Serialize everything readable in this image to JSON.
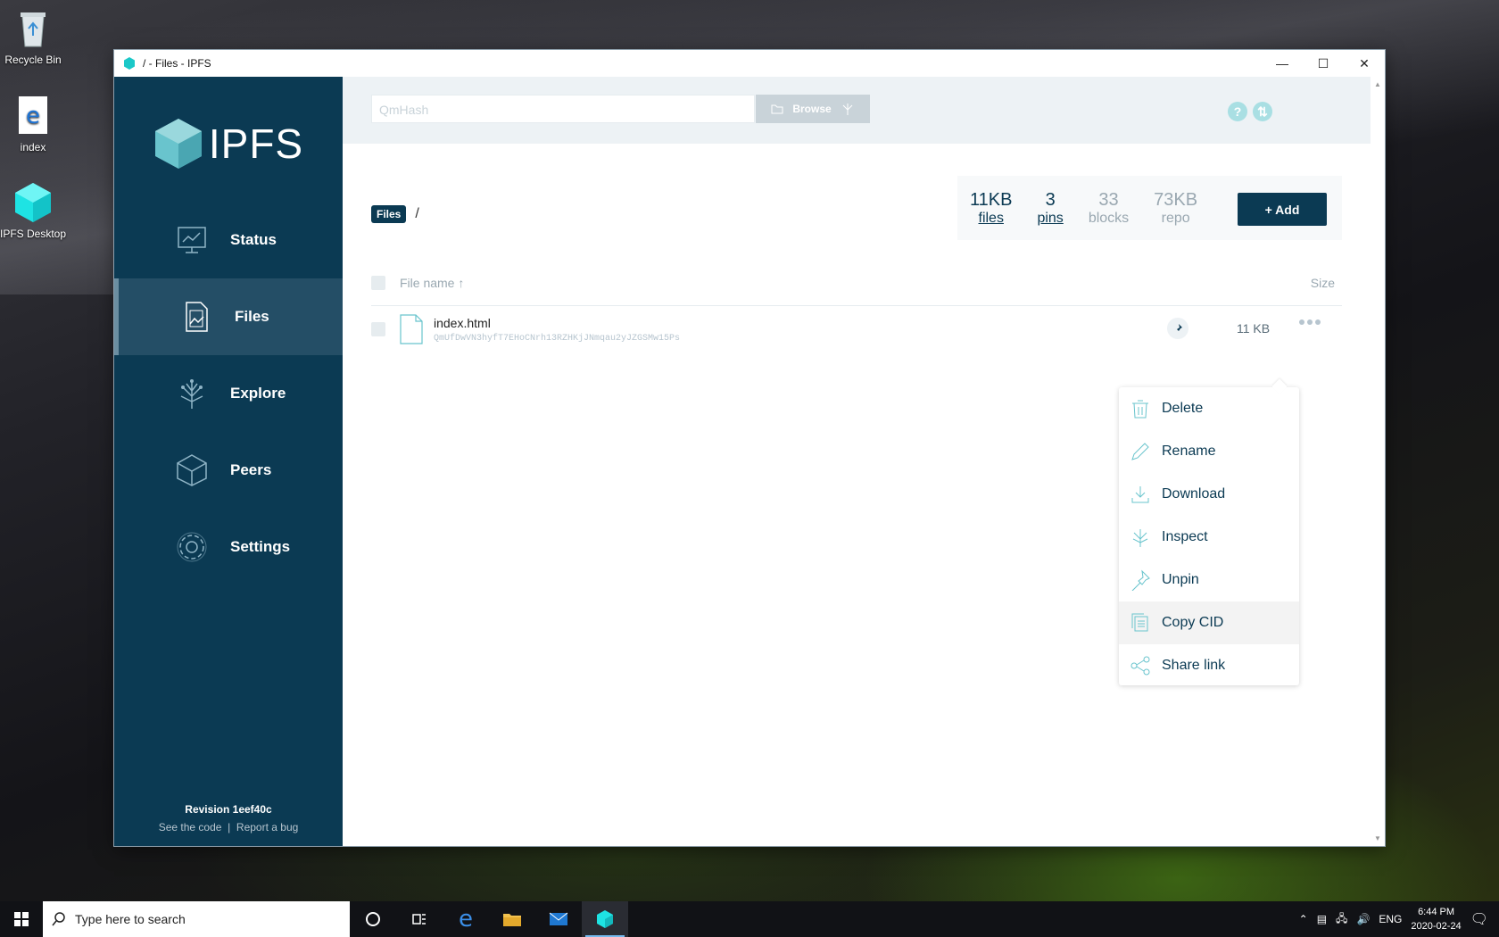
{
  "desktop": {
    "icons": [
      {
        "label": "Recycle Bin",
        "icon": "recycle-bin-icon"
      },
      {
        "label": "index",
        "icon": "edge-file-icon"
      },
      {
        "label": "IPFS Desktop",
        "icon": "ipfs-cube-icon"
      }
    ]
  },
  "window": {
    "title": "/ - Files - IPFS",
    "controls": [
      "minimize",
      "maximize",
      "close"
    ]
  },
  "sidebar": {
    "logo_text": "IPFS",
    "items": [
      {
        "label": "Status",
        "icon": "status-monitor-icon"
      },
      {
        "label": "Files",
        "icon": "files-icon",
        "active": true
      },
      {
        "label": "Explore",
        "icon": "explore-tree-icon"
      },
      {
        "label": "Peers",
        "icon": "peers-cube-icon"
      },
      {
        "label": "Settings",
        "icon": "gear-icon"
      }
    ],
    "revision": "Revision 1eef40c",
    "see_code": "See the code",
    "separator": "|",
    "report_bug": "Report a bug"
  },
  "topbar": {
    "search_placeholder": "QmHash",
    "browse_label": "Browse"
  },
  "breadcrumb": {
    "root": "Files",
    "sep": "/"
  },
  "stats": [
    {
      "value": "11KB",
      "label": "files"
    },
    {
      "value": "3",
      "label": "pins"
    },
    {
      "value": "33",
      "label": "blocks"
    },
    {
      "value": "73KB",
      "label": "repo"
    }
  ],
  "add_button": "+ Add",
  "table": {
    "col_name": "File name ↑",
    "col_size": "Size",
    "rows": [
      {
        "name": "index.html",
        "cid": "QmUfDwVN3hyfT7EHoCNrh13RZHKjJNmqau2yJZGSMw15Ps",
        "size": "11 KB"
      }
    ]
  },
  "context_menu": [
    {
      "label": "Delete",
      "icon": "trash-icon"
    },
    {
      "label": "Rename",
      "icon": "pencil-icon"
    },
    {
      "label": "Download",
      "icon": "download-icon"
    },
    {
      "label": "Inspect",
      "icon": "inspect-tree-icon"
    },
    {
      "label": "Unpin",
      "icon": "pin-icon"
    },
    {
      "label": "Copy CID",
      "icon": "copy-icon",
      "highlighted": true
    },
    {
      "label": "Share link",
      "icon": "share-icon"
    }
  ],
  "taskbar": {
    "search_placeholder": "Type here to search",
    "lang": "ENG",
    "time": "6:44 PM",
    "date": "2020-02-24"
  },
  "colors": {
    "navy": "#0b3a53",
    "teal": "#69c4cd",
    "active_nav": "#244e66"
  }
}
